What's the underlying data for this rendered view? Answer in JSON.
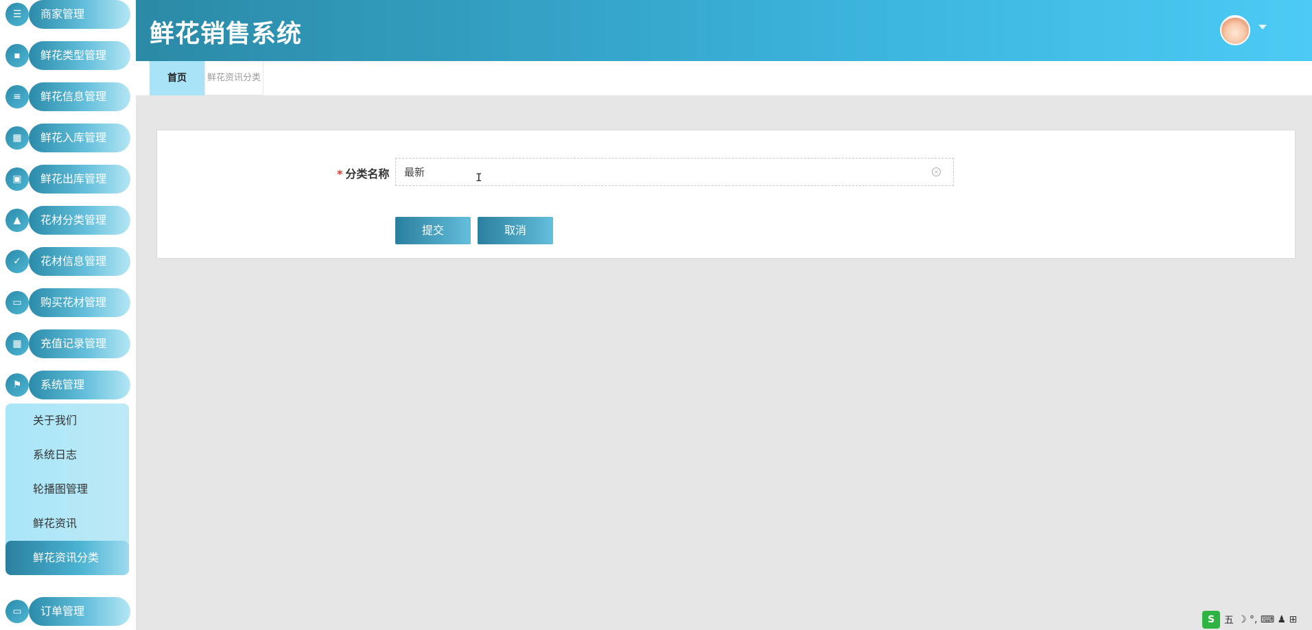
{
  "app": {
    "title": "鲜花销售系统"
  },
  "sidebar": {
    "items": [
      {
        "label": "商家管理",
        "icon": "sliders-icon"
      },
      {
        "label": "鲜花类型管理",
        "icon": "chat-icon"
      },
      {
        "label": "鲜花信息管理",
        "icon": "list-icon"
      },
      {
        "label": "鲜花入库管理",
        "icon": "grid-icon"
      },
      {
        "label": "鲜花出库管理",
        "icon": "clipboard-icon"
      },
      {
        "label": "花材分类管理",
        "icon": "thumbs-up-icon"
      },
      {
        "label": "花材信息管理",
        "icon": "checklist-icon"
      },
      {
        "label": "购买花材管理",
        "icon": "monitor-icon"
      },
      {
        "label": "充值记录管理",
        "icon": "grid-icon"
      },
      {
        "label": "系统管理",
        "icon": "flag-icon"
      }
    ],
    "submenu": [
      {
        "label": "关于我们"
      },
      {
        "label": "系统日志"
      },
      {
        "label": "轮播图管理"
      },
      {
        "label": "鲜花资讯"
      },
      {
        "label": "鲜花资讯分类",
        "active": true
      }
    ],
    "bottom_item": {
      "label": "订单管理",
      "icon": "desktop-icon"
    }
  },
  "tabs": {
    "home": "首页",
    "current": "鲜花资讯分类"
  },
  "form": {
    "required_mark": "*",
    "name_label": "分类名称",
    "name_value": "最新",
    "submit_label": "提交",
    "cancel_label": "取消"
  },
  "ime": {
    "logo": "S",
    "mode": "五",
    "extras": "☽ °, ⌨ ♟ ⊞"
  },
  "colors": {
    "header_start": "#2b8aa6",
    "header_end": "#4ccbf4",
    "accent": "#3bb3dc",
    "required": "#e33333"
  }
}
